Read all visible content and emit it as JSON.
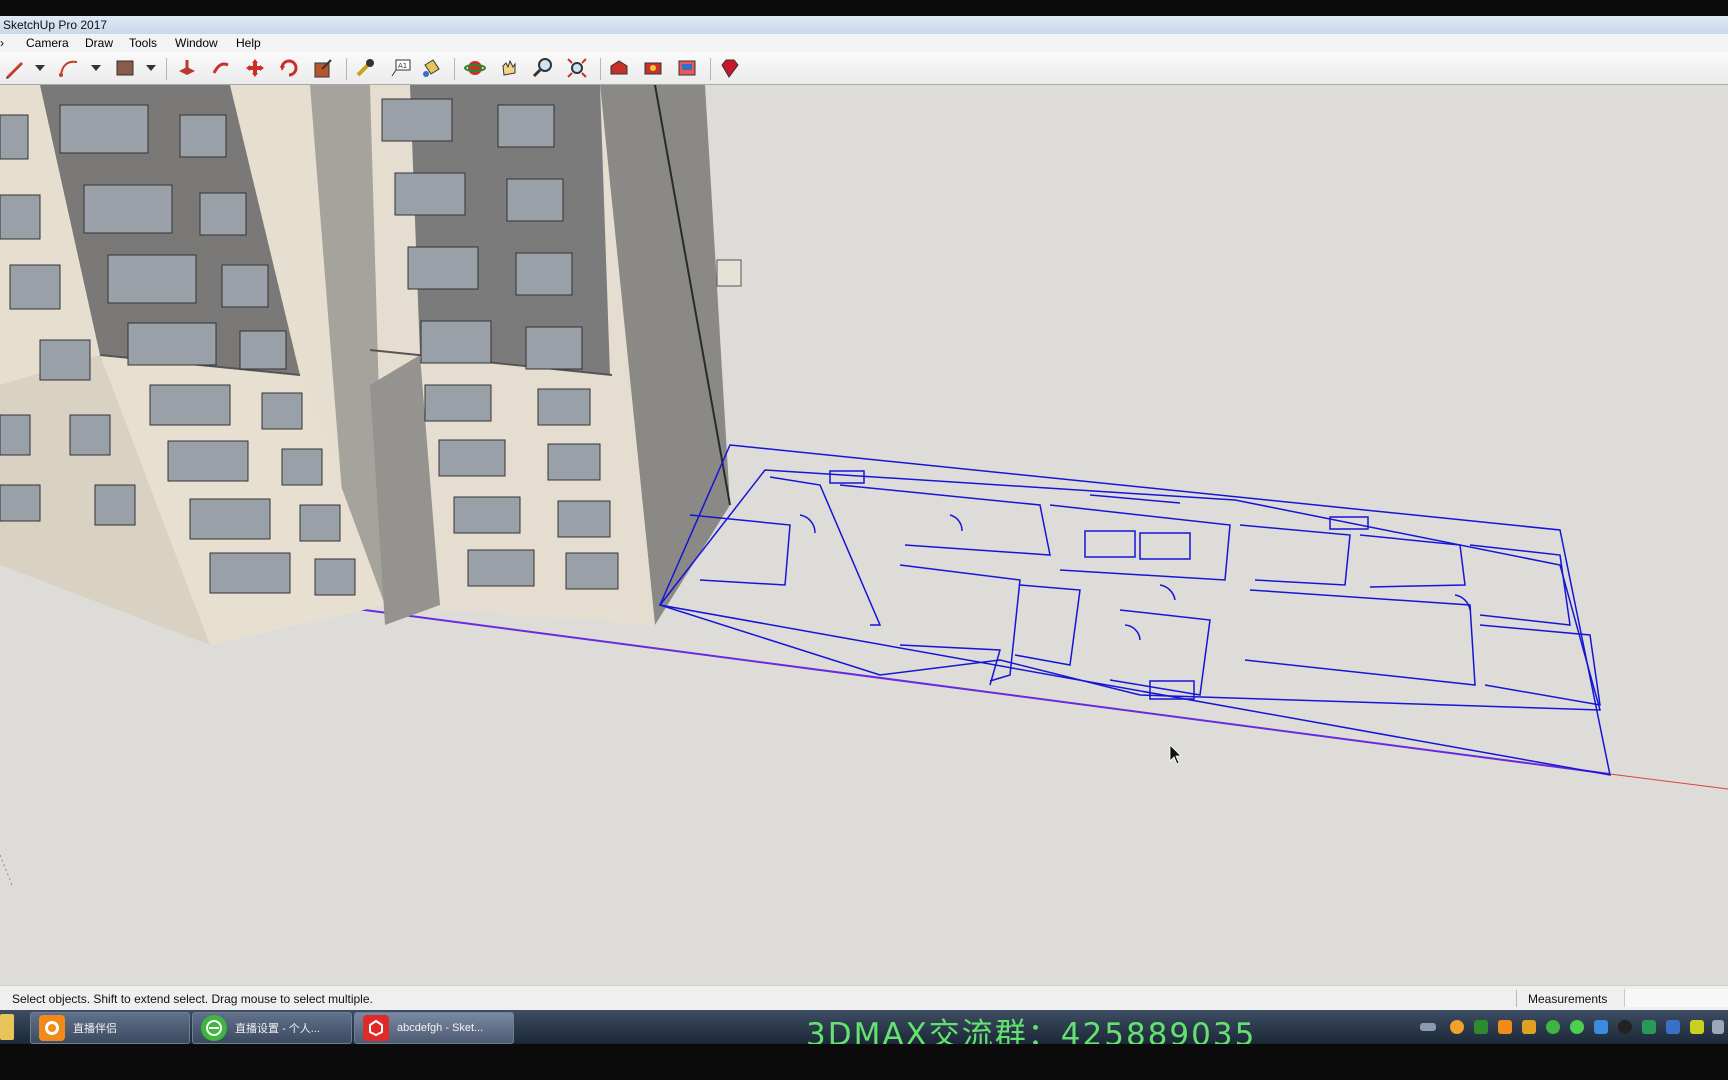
{
  "window": {
    "title": "SketchUp Pro 2017"
  },
  "menu": {
    "items": [
      "Camera",
      "Draw",
      "Tools",
      "Window",
      "Help"
    ]
  },
  "toolbar": {
    "buttons": [
      "pencil-icon",
      "arc-icon",
      "shape-icon",
      "push-pull-icon",
      "follow-me-icon",
      "move-icon",
      "rotate-icon",
      "scale-icon",
      "tape-measure-icon",
      "text-icon",
      "paint-bucket-icon",
      "orbit-icon",
      "pan-icon",
      "zoom-icon",
      "zoom-extents-icon",
      "warehouse-icon",
      "extension-icon",
      "layout-icon",
      "ruby-icon"
    ]
  },
  "statusbar": {
    "hint": "Select objects. Shift to extend select. Drag mouse to select multiple.",
    "measurements_label": "Measurements",
    "measurements_value": ""
  },
  "taskbar": {
    "tasks": [
      {
        "label": "直播伴侣",
        "icon": "live-companion-icon"
      },
      {
        "label": "直播设置 - 个人...",
        "icon": "browser-icon"
      },
      {
        "label": "abcdefgh - Sket...",
        "icon": "sketchup-icon"
      }
    ],
    "banner": "3DMAX交流群：425889035"
  },
  "colors": {
    "viewport_bg": "#dedcd8",
    "cad_lines": "#1515d8",
    "banner": "#63e36d",
    "facade_stone": "#e7e0d0",
    "facade_dark": "#7a7a7a"
  }
}
